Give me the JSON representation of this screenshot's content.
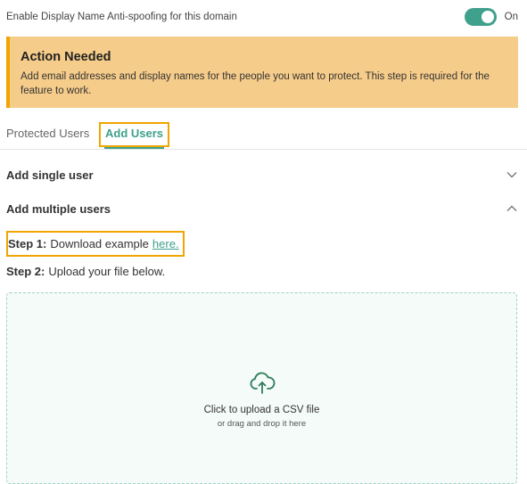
{
  "settings": {
    "antispoof_label": "Enable Display Name Anti-spoofing for this domain",
    "toggle_state_label": "On"
  },
  "alert": {
    "title": "Action Needed",
    "message": "Add email addresses and display names for the people you want to protect. This step is required for the feature to work."
  },
  "tabs": [
    {
      "label": "Protected Users"
    },
    {
      "label": "Add Users"
    }
  ],
  "accordion": {
    "single_user_label": "Add single user",
    "multiple_users_label": "Add multiple users"
  },
  "steps": {
    "step1_label": "Step 1:",
    "step1_text": "Download example",
    "step1_link": "here.",
    "step2_label": "Step 2:",
    "step2_text": "Upload your file below."
  },
  "upload": {
    "title": "Click to upload a CSV file",
    "subtitle": "or drag and drop it here",
    "icon": "cloud-upload-icon"
  },
  "colors": {
    "accent": "#3fa08c",
    "alert_bg": "#f6cc8a",
    "highlight": "#f0a500"
  }
}
